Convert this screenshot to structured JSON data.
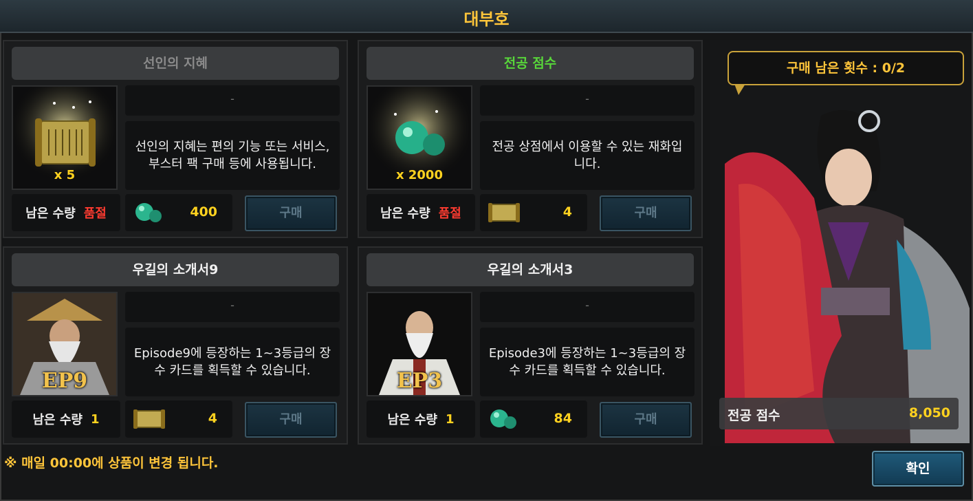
{
  "window": {
    "title": "대부호"
  },
  "shop": {
    "remaining_label": "남은 수량",
    "buy_label": "구매",
    "dash": "-",
    "items": [
      {
        "name": "선인의 지혜",
        "name_color": "#8a8a8a",
        "qty_badge": "x 5",
        "description": "선인의 지혜는 편의 기능 또는 서비스, 부스터 팩 구매 등에 사용됩니다.",
        "remaining": "품절",
        "price": "400",
        "currency_icon": "jade-orb-icon",
        "image": "scroll-icon"
      },
      {
        "name": "전공 점수",
        "name_color": "#58d63a",
        "qty_badge": "x 2000",
        "description": "전공 상점에서 이용할 수 있는 재화입니다.",
        "remaining": "품절",
        "price": "4",
        "currency_icon": "scroll-icon",
        "image": "jade-orb-icon"
      },
      {
        "name": "우길의 소개서9",
        "name_color": "#f0f0f0",
        "qty_badge": "EP9",
        "description": "Episode9에 등장하는 1~3등급의 장수 카드를 획득할 수 있습니다.",
        "remaining": "1",
        "price": "4",
        "currency_icon": "scroll-icon",
        "image": "sage-portrait"
      },
      {
        "name": "우길의 소개서3",
        "name_color": "#f0f0f0",
        "qty_badge": "EP3",
        "description": "Episode3에 등장하는 1~3등급의 장수 카드를 획득할 수 있습니다.",
        "remaining": "1",
        "price": "84",
        "currency_icon": "jade-orb-icon",
        "image": "sage-portrait"
      }
    ]
  },
  "footer": {
    "notice": "※ 매일 00:00에 상품이 변경 됩니다."
  },
  "merchant": {
    "purchases_left": "구매 남은 횟수 : 0/2",
    "score_label": "전공 점수",
    "score_value": "8,050"
  },
  "confirm_label": "확인"
}
